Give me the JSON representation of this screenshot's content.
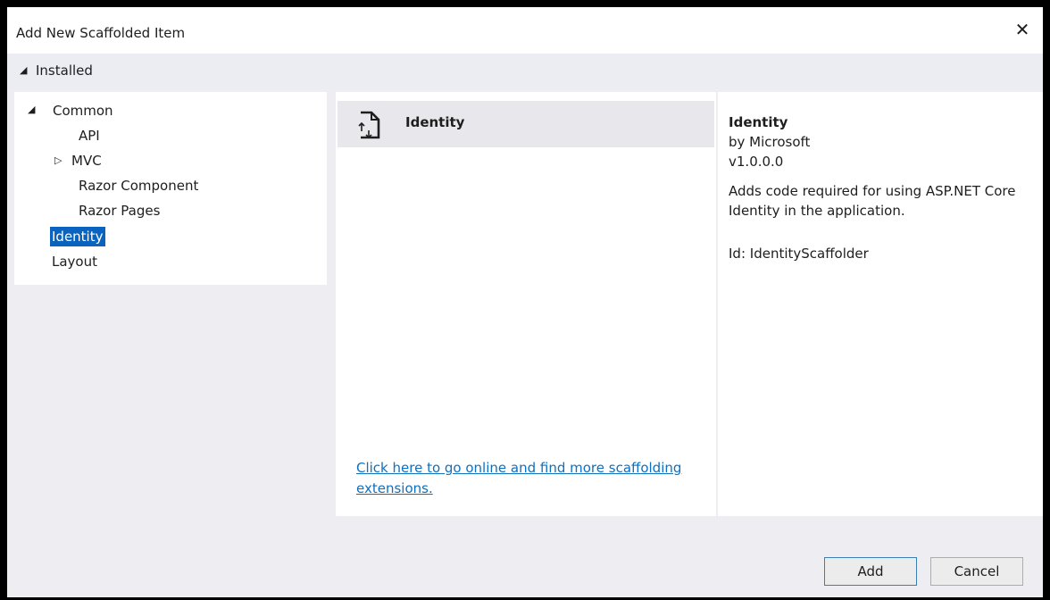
{
  "dialog": {
    "title": "Add New Scaffolded Item",
    "close_glyph": "✕"
  },
  "installed": {
    "label": "Installed",
    "glyph": "◢"
  },
  "tree": {
    "common": {
      "label": "Common",
      "glyph": "◢"
    },
    "api": "API",
    "mvc": {
      "label": "MVC",
      "glyph": "▷"
    },
    "razor_component": "Razor Component",
    "razor_pages": "Razor Pages",
    "identity": "Identity",
    "layout": "Layout"
  },
  "items": [
    {
      "name": "Identity",
      "icon": "scaffold-file-icon"
    }
  ],
  "online_link": "Click here to go online and find more scaffolding extensions.",
  "details": {
    "name": "Identity",
    "author": "by Microsoft",
    "version": "v1.0.0.0",
    "description": "Adds code required for using ASP.NET Core Identity in the application.",
    "id": "Id: IdentityScaffolder"
  },
  "buttons": {
    "add": "Add",
    "cancel": "Cancel"
  },
  "colors": {
    "selection": "#0a64bf",
    "link": "#0e70c0",
    "dialog_bg": "#eeeef2"
  }
}
